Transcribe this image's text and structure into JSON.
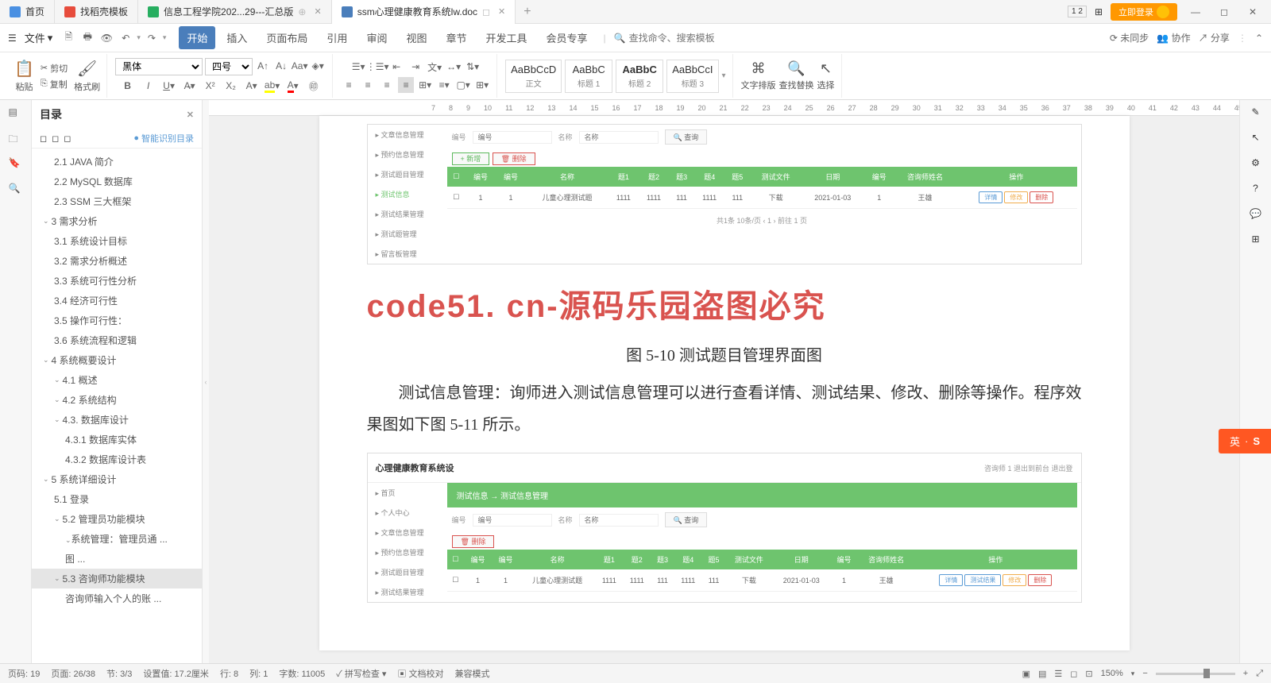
{
  "tabs": [
    {
      "label": "首页",
      "icon": "#4a90e2"
    },
    {
      "label": "找稻壳模板",
      "icon": "#e74c3c"
    },
    {
      "label": "信息工程学院202...29---汇总版",
      "icon": "#27ae60"
    },
    {
      "label": "ssm心理健康教育系统lw.doc",
      "icon": "#4a7ebb",
      "active": true
    }
  ],
  "login": "立即登录",
  "file_menu": "文件",
  "menu": [
    "开始",
    "插入",
    "页面布局",
    "引用",
    "审阅",
    "视图",
    "章节",
    "开发工具",
    "会员专享"
  ],
  "search_placeholder": "查找命令、搜索模板",
  "sync": "未同步",
  "collab": "协作",
  "share": "分享",
  "clipboard": {
    "paste": "粘贴",
    "cut": "剪切",
    "copy": "复制",
    "format": "格式刷"
  },
  "font": {
    "family": "黑体",
    "size": "四号"
  },
  "styles": [
    {
      "preview": "AaBbCcD",
      "name": "正文"
    },
    {
      "preview": "AaBbC",
      "name": "标题 1"
    },
    {
      "preview": "AaBbC",
      "name": "标题 2"
    },
    {
      "preview": "AaBbCcI",
      "name": "标题 3"
    }
  ],
  "tools": {
    "layout": "文字排版",
    "find": "查找替换",
    "select": "选择"
  },
  "toc": {
    "title": "目录",
    "smart": "智能识别目录",
    "items": [
      {
        "lvl": 2,
        "t": "2.1 JAVA 简介"
      },
      {
        "lvl": 2,
        "t": "2.2 MySQL 数据库"
      },
      {
        "lvl": 2,
        "t": "2.3 SSM 三大框架"
      },
      {
        "lvl": 1,
        "t": "3 需求分析",
        "c": true
      },
      {
        "lvl": 2,
        "t": "3.1 系统设计目标"
      },
      {
        "lvl": 2,
        "t": "3.2 需求分析概述"
      },
      {
        "lvl": 2,
        "t": "3.3 系统可行性分析"
      },
      {
        "lvl": 2,
        "t": "3.4 经济可行性"
      },
      {
        "lvl": 2,
        "t": "3.5 操作可行性："
      },
      {
        "lvl": 2,
        "t": "3.6 系统流程和逻辑"
      },
      {
        "lvl": 1,
        "t": "4 系统概要设计",
        "c": true
      },
      {
        "lvl": 2,
        "t": "4.1 概述",
        "c": true
      },
      {
        "lvl": 2,
        "t": "4.2 系统结构",
        "c": true
      },
      {
        "lvl": 2,
        "t": "4.3. 数据库设计",
        "c": true
      },
      {
        "lvl": 3,
        "t": "4.3.1 数据库实体"
      },
      {
        "lvl": 3,
        "t": "4.3.2 数据库设计表"
      },
      {
        "lvl": 1,
        "t": "5 系统详细设计",
        "c": true
      },
      {
        "lvl": 2,
        "t": "5.1 登录"
      },
      {
        "lvl": 2,
        "t": "5.2 管理员功能模块",
        "c": true
      },
      {
        "lvl": 3,
        "t": "系统管理：管理员通 ...",
        "c": true
      },
      {
        "lvl": 3,
        "t": "图 ..."
      },
      {
        "lvl": 2,
        "t": "5.3 咨询师功能模块",
        "c": true,
        "active": true
      },
      {
        "lvl": 3,
        "t": "咨询师输入个人的账 ..."
      }
    ]
  },
  "watermark": "code51. cn-源码乐园盗图必究",
  "caption1": "图 5-10 测试题目管理界面图",
  "body1": "测试信息管理：询师进入测试信息管理可以进行查看详情、测试结果、修改、删除等操作。程序效果图如下图 5-11 所示。",
  "ss1": {
    "side": [
      "文章信息管理",
      "预约信息管理",
      "测试题目管理",
      "测试信息",
      "测试结果管理",
      "测试题管理",
      "留言板管理"
    ],
    "side_active": "测试信息",
    "search": {
      "l1": "编号",
      "p1": "编号",
      "l2": "名称",
      "p2": "名称",
      "btn": "查询"
    },
    "add": "新增",
    "del": "删除",
    "headers": [
      "",
      "编号",
      "编号",
      "名称",
      "题1",
      "题2",
      "题3",
      "题4",
      "题5",
      "测试文件",
      "日期",
      "编号",
      "咨询师姓名",
      "操作"
    ],
    "row": [
      "",
      "1",
      "1",
      "儿童心理测试题",
      "1111",
      "1111",
      "111",
      "1111",
      "111",
      "下载",
      "2021-01-03",
      "1",
      "王雄"
    ],
    "actions": [
      "详情",
      "修改",
      "删除"
    ],
    "pager": "共1条  10条/页  ‹  1  ›  前往  1  页"
  },
  "ss2": {
    "title": "心理健康教育系统设",
    "right": "咨询师 1  退出到前台  退出登",
    "crumb": "测试信息  →  测试信息管理",
    "side": [
      "首页",
      "个人中心",
      "文章信息管理",
      "预约信息管理",
      "测试题目管理",
      "测试结果管理"
    ],
    "headers": [
      "",
      "编号",
      "编号",
      "名称",
      "题1",
      "题2",
      "题3",
      "题4",
      "题5",
      "测试文件",
      "日期",
      "编号",
      "咨询师姓名",
      "操作"
    ],
    "row": [
      "",
      "1",
      "1",
      "儿童心理测试题",
      "1111",
      "1111",
      "111",
      "1111",
      "111",
      "下载",
      "2021-01-03",
      "1",
      "王雄"
    ],
    "actions": [
      "详情",
      "测试结果",
      "修改",
      "删除"
    ],
    "search": {
      "l1": "编号",
      "p1": "编号",
      "l2": "名称",
      "p2": "名称",
      "btn": "查询"
    },
    "del": "删除"
  },
  "status": {
    "page": "页码: 19",
    "pages": "页面: 26/38",
    "sec": "节: 3/3",
    "pos": "设置值: 17.2厘米",
    "row": "行: 8",
    "col": "列: 1",
    "words": "字数: 11005",
    "spell": "拼写检查",
    "proof": "文档校对",
    "compat": "兼容模式",
    "zoom": "150%"
  },
  "ime": "英"
}
